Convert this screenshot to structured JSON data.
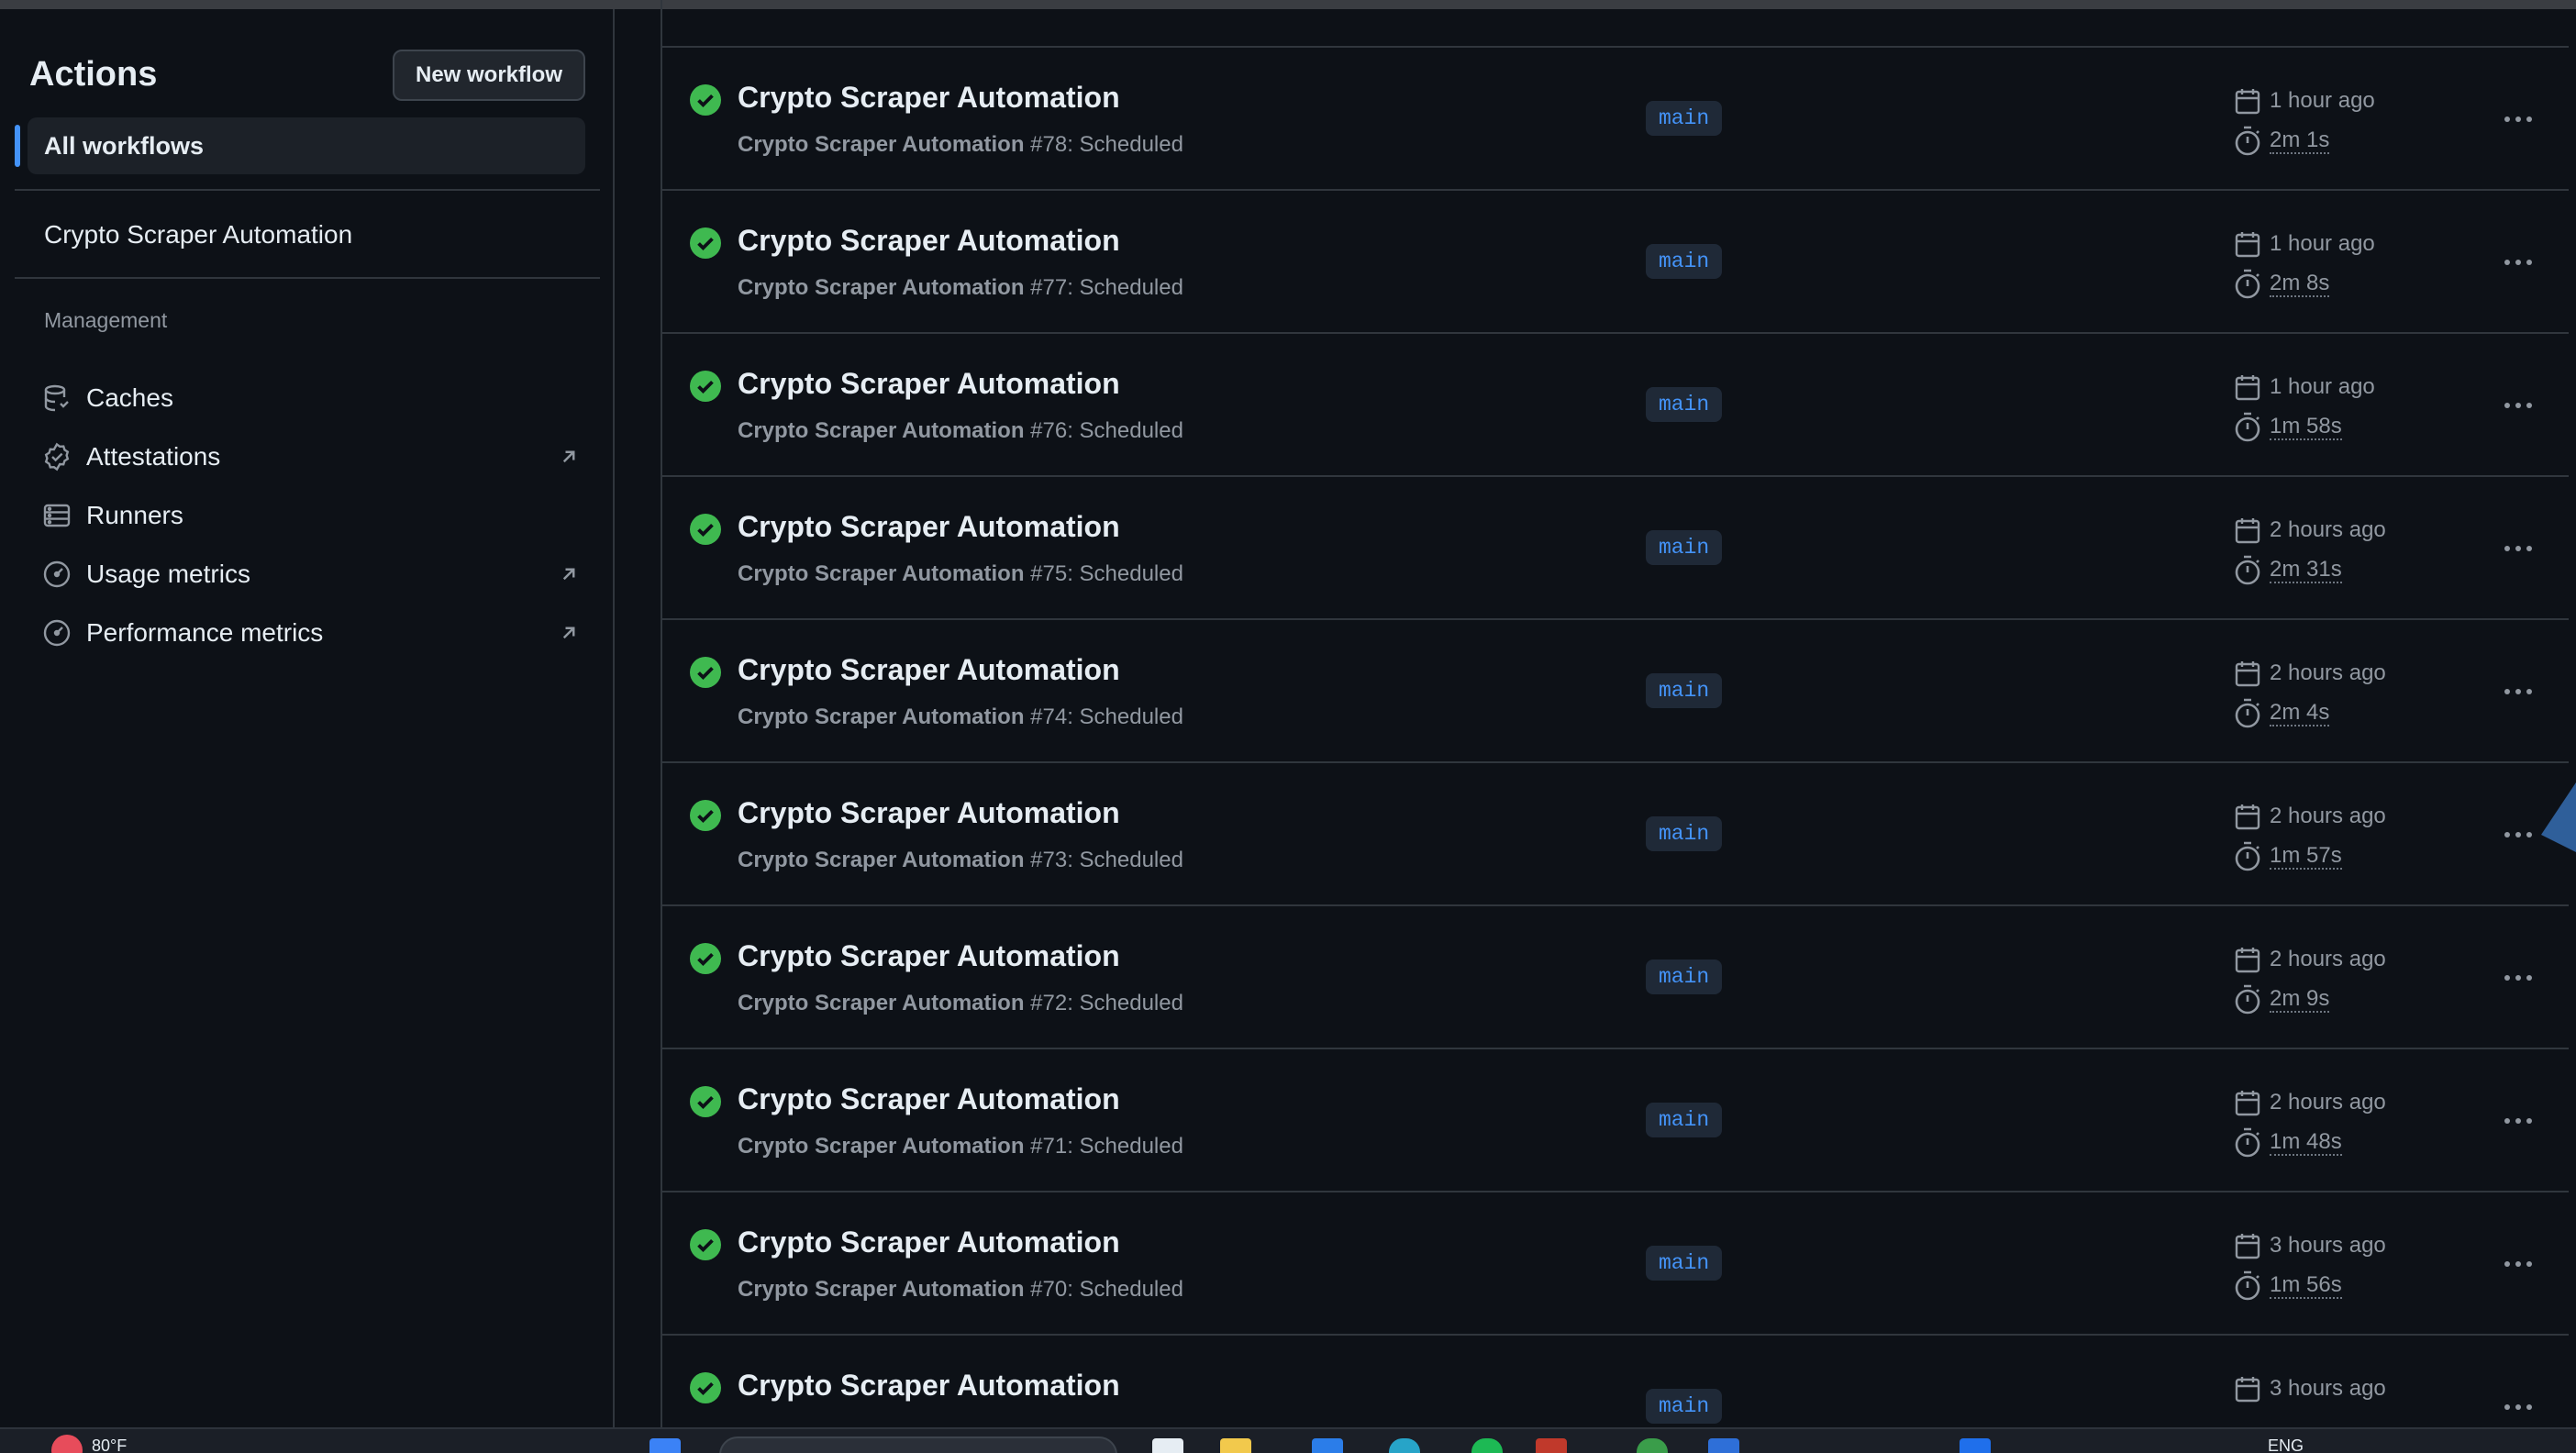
{
  "sidebar": {
    "title": "Actions",
    "new_workflow_label": "New workflow",
    "all_workflows_label": "All workflows",
    "workflow_items": [
      "Crypto Scraper Automation"
    ],
    "management_heading": "Management",
    "management_items": [
      {
        "label": "Caches",
        "icon": "database-icon",
        "external": false
      },
      {
        "label": "Attestations",
        "icon": "verified-icon",
        "external": true
      },
      {
        "label": "Runners",
        "icon": "server-icon",
        "external": false
      },
      {
        "label": "Usage metrics",
        "icon": "meter-icon",
        "external": true
      },
      {
        "label": "Performance metrics",
        "icon": "meter-icon",
        "external": true
      }
    ]
  },
  "runs": [
    {
      "title": "Crypto Scraper Automation",
      "workflow": "Crypto Scraper Automation",
      "number": "#78: Scheduled",
      "branch": "main",
      "time_ago": "1 hour ago",
      "duration": "2m 1s",
      "status": "success"
    },
    {
      "title": "Crypto Scraper Automation",
      "workflow": "Crypto Scraper Automation",
      "number": "#77: Scheduled",
      "branch": "main",
      "time_ago": "1 hour ago",
      "duration": "2m 8s",
      "status": "success"
    },
    {
      "title": "Crypto Scraper Automation",
      "workflow": "Crypto Scraper Automation",
      "number": "#76: Scheduled",
      "branch": "main",
      "time_ago": "1 hour ago",
      "duration": "1m 58s",
      "status": "success"
    },
    {
      "title": "Crypto Scraper Automation",
      "workflow": "Crypto Scraper Automation",
      "number": "#75: Scheduled",
      "branch": "main",
      "time_ago": "2 hours ago",
      "duration": "2m 31s",
      "status": "success"
    },
    {
      "title": "Crypto Scraper Automation",
      "workflow": "Crypto Scraper Automation",
      "number": "#74: Scheduled",
      "branch": "main",
      "time_ago": "2 hours ago",
      "duration": "2m 4s",
      "status": "success"
    },
    {
      "title": "Crypto Scraper Automation",
      "workflow": "Crypto Scraper Automation",
      "number": "#73: Scheduled",
      "branch": "main",
      "time_ago": "2 hours ago",
      "duration": "1m 57s",
      "status": "success"
    },
    {
      "title": "Crypto Scraper Automation",
      "workflow": "Crypto Scraper Automation",
      "number": "#72: Scheduled",
      "branch": "main",
      "time_ago": "2 hours ago",
      "duration": "2m 9s",
      "status": "success"
    },
    {
      "title": "Crypto Scraper Automation",
      "workflow": "Crypto Scraper Automation",
      "number": "#71: Scheduled",
      "branch": "main",
      "time_ago": "2 hours ago",
      "duration": "1m 48s",
      "status": "success"
    },
    {
      "title": "Crypto Scraper Automation",
      "workflow": "Crypto Scraper Automation",
      "number": "#70: Scheduled",
      "branch": "main",
      "time_ago": "3 hours ago",
      "duration": "1m 56s",
      "status": "success"
    },
    {
      "title": "Crypto Scraper Automation",
      "workflow": "",
      "number": "",
      "branch": "main",
      "time_ago": "3 hours ago",
      "duration": "",
      "status": "success"
    }
  ],
  "taskbar": {
    "temperature": "80°F",
    "language": "ENG"
  },
  "colors": {
    "background": "#0d1117",
    "success": "#3fb950",
    "accent": "#4493f8",
    "muted": "#9198a1",
    "border": "#30363d"
  }
}
